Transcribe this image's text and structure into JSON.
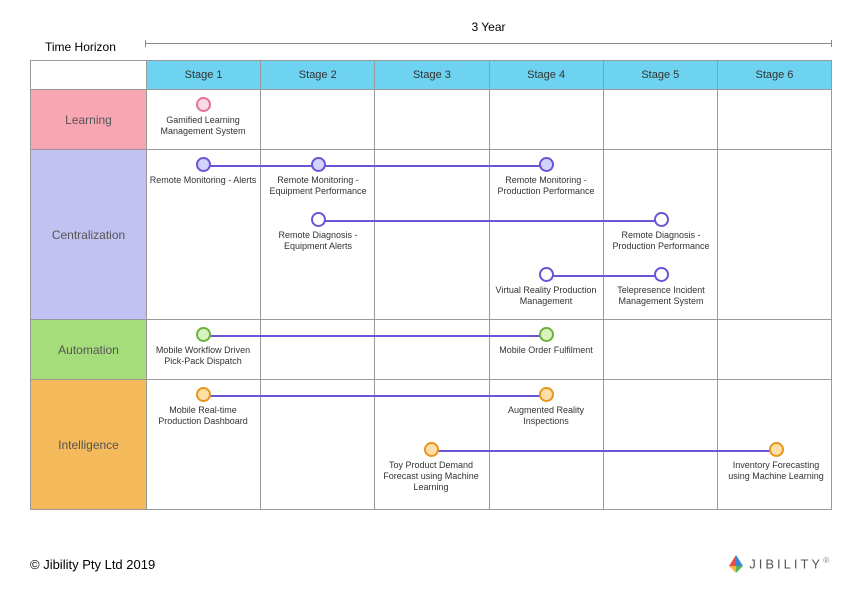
{
  "timeHorizon": {
    "label": "Time Horizon",
    "title": "3 Year"
  },
  "stages": [
    "Stage 1",
    "Stage 2",
    "Stage 3",
    "Stage 4",
    "Stage 5",
    "Stage 6"
  ],
  "rows": {
    "learning": "Learning",
    "centralization": "Centralization",
    "automation": "Automation",
    "intelligence": "Intelligence"
  },
  "nodes": {
    "gamified": "Gamified Learning Management System",
    "rmAlerts": "Remote Monitoring - Alerts",
    "rmEquip": "Remote Monitoring - Equipment Performance",
    "rmProd": "Remote Monitoring - Production Performance",
    "rdEquip": "Remote Diagnosis - Equipment Alerts",
    "rdProd": "Remote Diagnosis - Production Performance",
    "vrProd": "Virtual Reality Production Management",
    "teleIncident": "Telepresence Incident Management System",
    "mobileWorkflow": "Mobile Workflow Driven Pick-Pack Dispatch",
    "mobileOrder": "Mobile Order Fulfilment",
    "mobileDashboard": "Mobile Real-time Production Dashboard",
    "arInspections": "Augmented Reality Inspections",
    "toyDemand": "Toy Product Demand Forecast using Machine Learning",
    "invForecast": "Inventory Forecasting using Machine Learning"
  },
  "copyright": "© Jibility Pty Ltd 2019",
  "logoText": "JIBILITY"
}
